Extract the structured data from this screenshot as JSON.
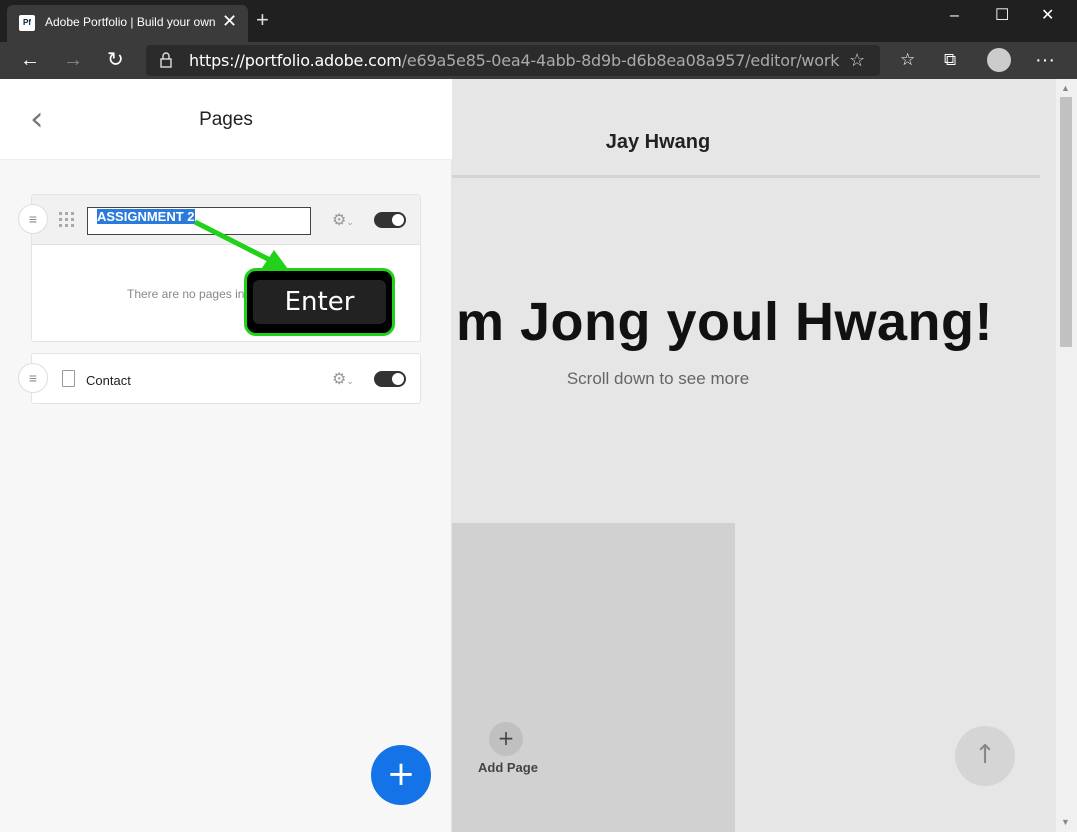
{
  "browser": {
    "tab_title": "Adobe Portfolio | Build your own",
    "favicon_text": "Pf",
    "url_host": "https://portfolio.adobe.com",
    "url_path": "/e69a5e85-0ea4-4abb-8d9b-d6b8ea08a957/editor/work"
  },
  "sidebar": {
    "title": "Pages",
    "items": [
      {
        "label": "ASSIGNMENT 2",
        "empty_note": "There are no pages in"
      },
      {
        "label": "Contact"
      }
    ]
  },
  "canvas": {
    "site_name": "Jay Hwang",
    "hero_text": "m Jong youl Hwang!",
    "scroll_note": "Scroll down to see more",
    "add_page_label": "Add Page"
  },
  "callout": {
    "key_label": "Enter"
  },
  "colors": {
    "accent": "#1473e6",
    "highlight": "#22d11a",
    "selection": "#2b7bdb"
  }
}
